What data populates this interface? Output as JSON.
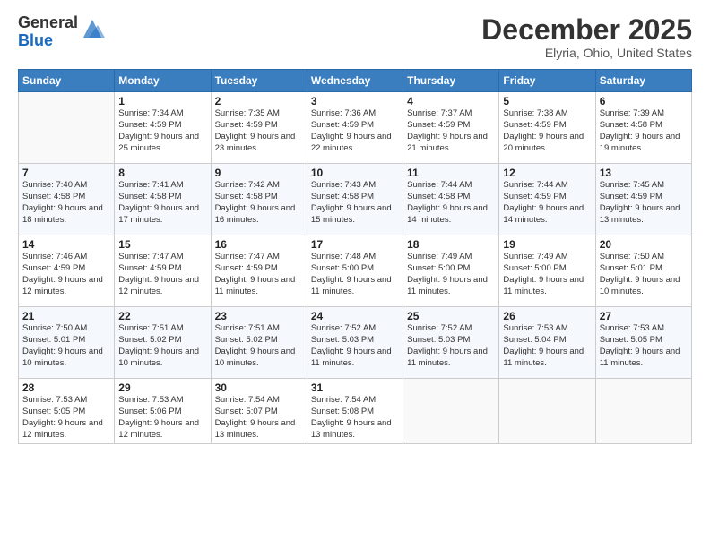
{
  "logo": {
    "general": "General",
    "blue": "Blue"
  },
  "header": {
    "month": "December 2025",
    "location": "Elyria, Ohio, United States"
  },
  "days_of_week": [
    "Sunday",
    "Monday",
    "Tuesday",
    "Wednesday",
    "Thursday",
    "Friday",
    "Saturday"
  ],
  "weeks": [
    [
      {
        "day": "",
        "sunrise": "",
        "sunset": "",
        "daylight": ""
      },
      {
        "day": "1",
        "sunrise": "7:34 AM",
        "sunset": "4:59 PM",
        "daylight": "9 hours and 25 minutes."
      },
      {
        "day": "2",
        "sunrise": "7:35 AM",
        "sunset": "4:59 PM",
        "daylight": "9 hours and 23 minutes."
      },
      {
        "day": "3",
        "sunrise": "7:36 AM",
        "sunset": "4:59 PM",
        "daylight": "9 hours and 22 minutes."
      },
      {
        "day": "4",
        "sunrise": "7:37 AM",
        "sunset": "4:59 PM",
        "daylight": "9 hours and 21 minutes."
      },
      {
        "day": "5",
        "sunrise": "7:38 AM",
        "sunset": "4:59 PM",
        "daylight": "9 hours and 20 minutes."
      },
      {
        "day": "6",
        "sunrise": "7:39 AM",
        "sunset": "4:58 PM",
        "daylight": "9 hours and 19 minutes."
      }
    ],
    [
      {
        "day": "7",
        "sunrise": "7:40 AM",
        "sunset": "4:58 PM",
        "daylight": "9 hours and 18 minutes."
      },
      {
        "day": "8",
        "sunrise": "7:41 AM",
        "sunset": "4:58 PM",
        "daylight": "9 hours and 17 minutes."
      },
      {
        "day": "9",
        "sunrise": "7:42 AM",
        "sunset": "4:58 PM",
        "daylight": "9 hours and 16 minutes."
      },
      {
        "day": "10",
        "sunrise": "7:43 AM",
        "sunset": "4:58 PM",
        "daylight": "9 hours and 15 minutes."
      },
      {
        "day": "11",
        "sunrise": "7:44 AM",
        "sunset": "4:58 PM",
        "daylight": "9 hours and 14 minutes."
      },
      {
        "day": "12",
        "sunrise": "7:44 AM",
        "sunset": "4:59 PM",
        "daylight": "9 hours and 14 minutes."
      },
      {
        "day": "13",
        "sunrise": "7:45 AM",
        "sunset": "4:59 PM",
        "daylight": "9 hours and 13 minutes."
      }
    ],
    [
      {
        "day": "14",
        "sunrise": "7:46 AM",
        "sunset": "4:59 PM",
        "daylight": "9 hours and 12 minutes."
      },
      {
        "day": "15",
        "sunrise": "7:47 AM",
        "sunset": "4:59 PM",
        "daylight": "9 hours and 12 minutes."
      },
      {
        "day": "16",
        "sunrise": "7:47 AM",
        "sunset": "4:59 PM",
        "daylight": "9 hours and 11 minutes."
      },
      {
        "day": "17",
        "sunrise": "7:48 AM",
        "sunset": "5:00 PM",
        "daylight": "9 hours and 11 minutes."
      },
      {
        "day": "18",
        "sunrise": "7:49 AM",
        "sunset": "5:00 PM",
        "daylight": "9 hours and 11 minutes."
      },
      {
        "day": "19",
        "sunrise": "7:49 AM",
        "sunset": "5:00 PM",
        "daylight": "9 hours and 11 minutes."
      },
      {
        "day": "20",
        "sunrise": "7:50 AM",
        "sunset": "5:01 PM",
        "daylight": "9 hours and 10 minutes."
      }
    ],
    [
      {
        "day": "21",
        "sunrise": "7:50 AM",
        "sunset": "5:01 PM",
        "daylight": "9 hours and 10 minutes."
      },
      {
        "day": "22",
        "sunrise": "7:51 AM",
        "sunset": "5:02 PM",
        "daylight": "9 hours and 10 minutes."
      },
      {
        "day": "23",
        "sunrise": "7:51 AM",
        "sunset": "5:02 PM",
        "daylight": "9 hours and 10 minutes."
      },
      {
        "day": "24",
        "sunrise": "7:52 AM",
        "sunset": "5:03 PM",
        "daylight": "9 hours and 11 minutes."
      },
      {
        "day": "25",
        "sunrise": "7:52 AM",
        "sunset": "5:03 PM",
        "daylight": "9 hours and 11 minutes."
      },
      {
        "day": "26",
        "sunrise": "7:53 AM",
        "sunset": "5:04 PM",
        "daylight": "9 hours and 11 minutes."
      },
      {
        "day": "27",
        "sunrise": "7:53 AM",
        "sunset": "5:05 PM",
        "daylight": "9 hours and 11 minutes."
      }
    ],
    [
      {
        "day": "28",
        "sunrise": "7:53 AM",
        "sunset": "5:05 PM",
        "daylight": "9 hours and 12 minutes."
      },
      {
        "day": "29",
        "sunrise": "7:53 AM",
        "sunset": "5:06 PM",
        "daylight": "9 hours and 12 minutes."
      },
      {
        "day": "30",
        "sunrise": "7:54 AM",
        "sunset": "5:07 PM",
        "daylight": "9 hours and 13 minutes."
      },
      {
        "day": "31",
        "sunrise": "7:54 AM",
        "sunset": "5:08 PM",
        "daylight": "9 hours and 13 minutes."
      },
      {
        "day": "",
        "sunrise": "",
        "sunset": "",
        "daylight": ""
      },
      {
        "day": "",
        "sunrise": "",
        "sunset": "",
        "daylight": ""
      },
      {
        "day": "",
        "sunrise": "",
        "sunset": "",
        "daylight": ""
      }
    ]
  ],
  "labels": {
    "sunrise": "Sunrise:",
    "sunset": "Sunset:",
    "daylight": "Daylight:"
  }
}
